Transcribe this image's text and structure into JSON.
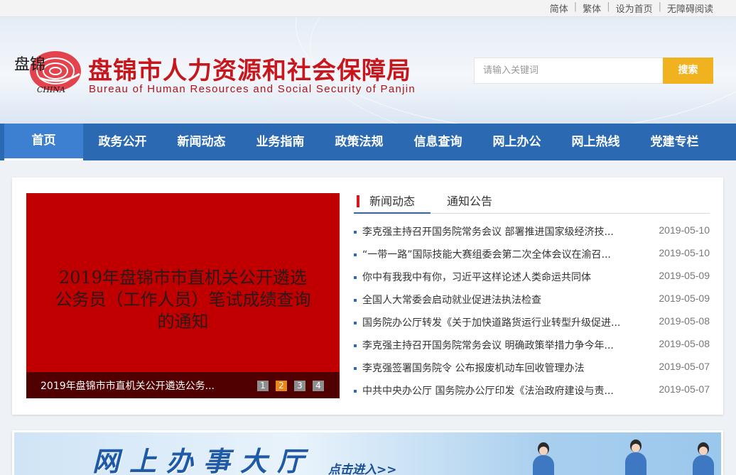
{
  "topbar": {
    "links": [
      "简体",
      "繁体",
      "设为首页",
      "无障碍阅读"
    ]
  },
  "header": {
    "logo_text": "盘锦",
    "logo_sub": "CHINA",
    "title": "盘锦市人力资源和社会保障局",
    "subtitle": "Bureau of Human Resources and Social Security of Panjin",
    "search_placeholder": "请输入关键词",
    "search_button": "搜索"
  },
  "nav": {
    "items": [
      "首页",
      "政务公开",
      "新闻动态",
      "业务指南",
      "政策法规",
      "信息查询",
      "网上办公",
      "网上热线",
      "党建专栏"
    ],
    "active_index": 0
  },
  "slider": {
    "headline": "2019年盘锦市市直机关公开遴选公务员（工作人员）笔试成绩查询的通知",
    "caption": "2019年盘锦市市直机关公开遴选公务...",
    "pages": [
      "1",
      "2",
      "3",
      "4"
    ],
    "active_page": "2",
    "bg_color": "#c00000"
  },
  "news": {
    "tabs": [
      "新闻动态",
      "通知公告"
    ],
    "items": [
      {
        "title": "李克强主持召开国务院常务会议 部署推进国家级经济技...",
        "date": "2019-05-10"
      },
      {
        "title": "“一带一路”国际技能大赛组委会第二次全体会议在渝召...",
        "date": "2019-05-10"
      },
      {
        "title": "你中有我我中有你，习近平这样论述人类命运共同体",
        "date": "2019-05-09"
      },
      {
        "title": "全国人大常委会启动就业促进法执法检查",
        "date": "2019-05-09"
      },
      {
        "title": "国务院办公厅转发《关于加快道路货运行业转型升级促进...",
        "date": "2019-05-08"
      },
      {
        "title": "李克强主持召开国务院常务会议 明确政策举措力争今年...",
        "date": "2019-05-08"
      },
      {
        "title": "李克强签署国务院令 公布报废机动车回收管理办法",
        "date": "2019-05-07"
      },
      {
        "title": "中共中央办公厅 国务院办公厅印发《法治政府建设与责...",
        "date": "2019-05-07"
      }
    ]
  },
  "banner": {
    "title": "网上办事大厅",
    "enter": "点击进入>>"
  },
  "colors": {
    "nav": "#2b69b3",
    "title_red": "#c8161d",
    "search_button": "#f1b21f"
  }
}
